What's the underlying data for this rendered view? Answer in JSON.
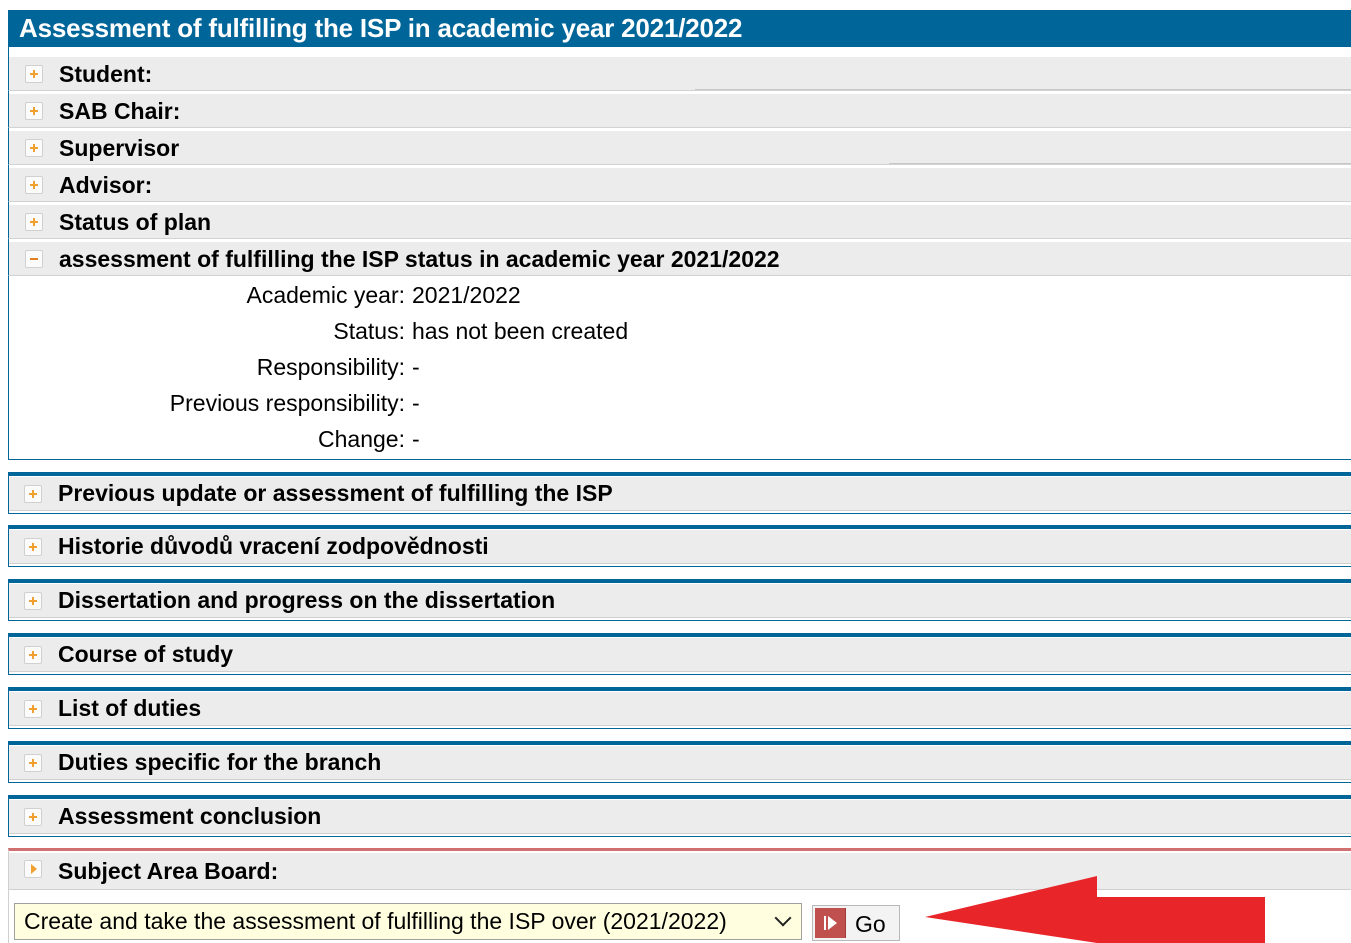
{
  "header": {
    "title": "Assessment of fulfilling the ISP in academic year 2021/2022"
  },
  "sections": [
    {
      "label": "Student:"
    },
    {
      "label": "SAB Chair:"
    },
    {
      "label": "Supervisor"
    },
    {
      "label": "Advisor:"
    },
    {
      "label": "Status of plan"
    }
  ],
  "expanded": {
    "label": "assessment of fulfilling the ISP status in academic year 2021/2022",
    "fields": [
      {
        "label": "Academic year:",
        "value": "2021/2022"
      },
      {
        "label": "Status:",
        "value": "has not been created"
      },
      {
        "label": "Responsibility:",
        "value": "-"
      },
      {
        "label": "Previous responsibility:",
        "value": "-"
      },
      {
        "label": "Change:",
        "value": "-"
      }
    ]
  },
  "panels": [
    {
      "label": "Previous update or assessment of fulfilling the ISP"
    },
    {
      "label": "Historie důvodů vracení zodpovědnosti"
    },
    {
      "label": "Dissertation and progress on the dissertation"
    },
    {
      "label": "Course of study"
    },
    {
      "label": "List of duties"
    },
    {
      "label": "Duties specific for the branch"
    },
    {
      "label": "Assessment conclusion"
    }
  ],
  "subject_area_board": {
    "label": "Subject Area Board:",
    "select_value": "Create and take the assessment of fulfilling the ISP over (2021/2022)",
    "go_label": "Go"
  },
  "colors": {
    "header_bg": "#006699",
    "row_bg": "#ececec",
    "plus_icon": "#f0a030",
    "select_bg": "#ffffe0",
    "arrow": "#e8262a"
  },
  "icons": {
    "collapsed": "plus-icon",
    "expanded": "minus-icon",
    "sab": "arrow-right-icon",
    "go": "play-icon",
    "select": "chevron-down-icon"
  }
}
